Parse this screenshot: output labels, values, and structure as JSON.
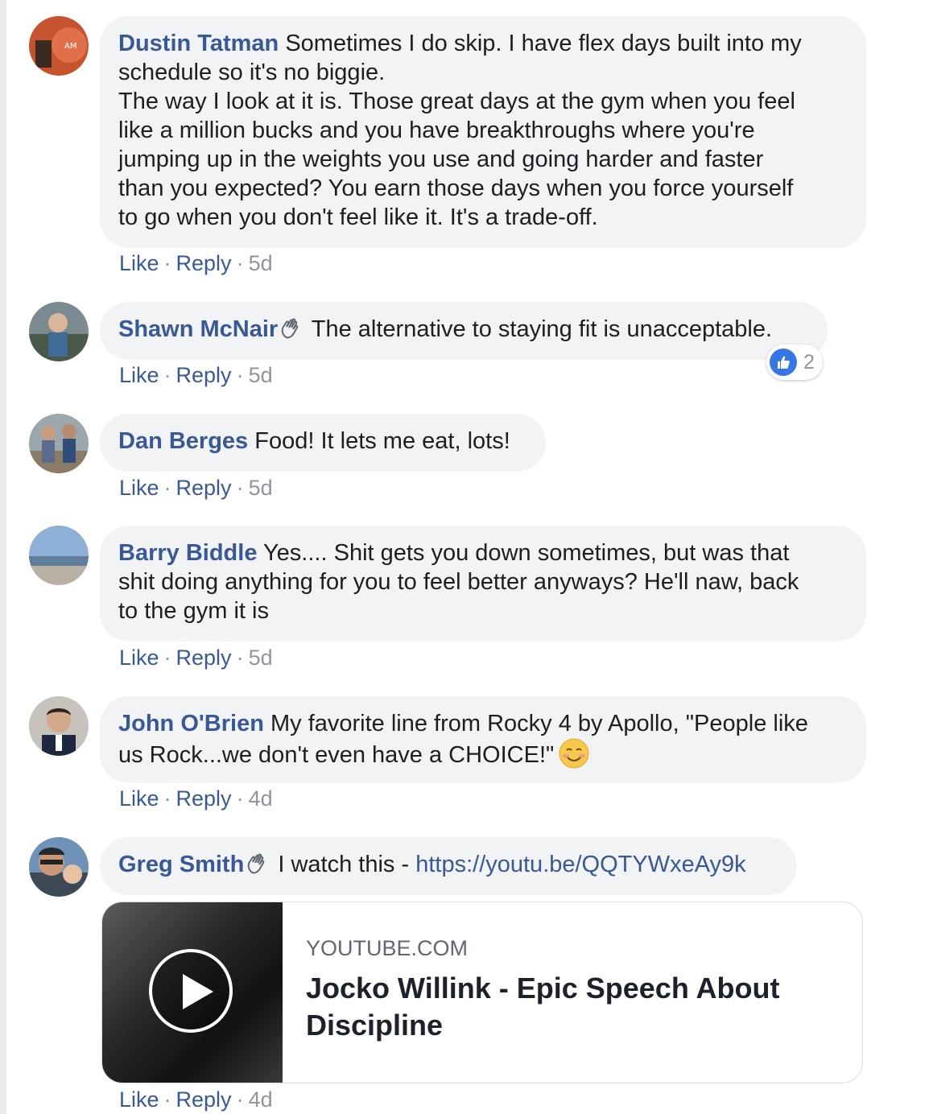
{
  "actions": {
    "like": "Like",
    "reply": "Reply",
    "separator": "·"
  },
  "comments": [
    {
      "author": "Dustin Tatman",
      "text": "Sometimes I do skip. I have flex days built into my\nschedule so it's no biggie.\nThe way I look at it is. Those great days at the gym when you feel\nlike a million bucks and you have breakthroughs where you're\njumping up in the weights you use and going harder and faster\nthan you expected? You earn those days when you force yourself\nto go when you don't feel like it. It's a trade-off.",
      "time": "5d"
    },
    {
      "author": "Shawn McNair",
      "badge_icon": "waving-hand-icon",
      "text": "The alternative to staying fit is unacceptable.",
      "time": "5d",
      "reaction": {
        "icon": "thumbs-up-icon",
        "count": "2"
      }
    },
    {
      "author": "Dan Berges",
      "text": "Food! It lets me eat, lots!",
      "time": "5d"
    },
    {
      "author": "Barry Biddle",
      "text": "Yes.... Shit gets you down sometimes, but was that\nshit doing anything for you to feel better anyways? He'll naw, back\nto the gym it is",
      "time": "5d"
    },
    {
      "author": "John O'Brien",
      "text": "My favorite line from Rocky 4 by Apollo, \"People like\nus Rock...we don't even have a CHOICE!\"",
      "emoji": "smiling-face-icon",
      "time": "4d"
    },
    {
      "author": "Greg Smith",
      "badge_icon": "waving-hand-icon",
      "text": "I watch this - ",
      "link": "https://youtu.be/QQTYWxeAy9k",
      "time": "4d",
      "preview": {
        "domain": "YOUTUBE.COM",
        "title": "Jocko Willink - Epic Speech About Discipline",
        "icon": "play-icon"
      }
    }
  ],
  "colors": {
    "name": "#385898",
    "bubble": "#f2f3f5",
    "meta": "#90949c",
    "reaction": "#3578e5"
  }
}
